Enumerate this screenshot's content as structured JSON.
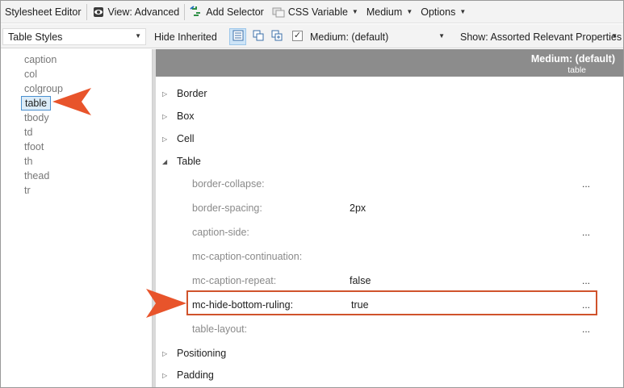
{
  "toolbar": {
    "title": "Stylesheet Editor",
    "view_label": "View: Advanced",
    "add_selector_label": "Add Selector",
    "css_variable_label": "CSS Variable",
    "medium_label": "Medium",
    "options_label": "Options"
  },
  "toolbar2": {
    "style_select": "Table Styles",
    "hide_inherited": "Hide Inherited",
    "medium_select": "Medium: (default)",
    "show_select": "Show: Assorted Relevant Properties"
  },
  "tags": [
    "caption",
    "col",
    "colgroup",
    "table",
    "tbody",
    "td",
    "tfoot",
    "th",
    "thead",
    "tr"
  ],
  "selected_tag": "table",
  "header": {
    "medium": "Medium: (default)",
    "selector": "table"
  },
  "groups": {
    "border": "Border",
    "box": "Box",
    "cell": "Cell",
    "table": "Table",
    "positioning": "Positioning",
    "padding": "Padding"
  },
  "properties": [
    {
      "name": "border-collapse:",
      "value": "",
      "more": "..."
    },
    {
      "name": "border-spacing:",
      "value": "2px",
      "more": ""
    },
    {
      "name": "caption-side:",
      "value": "",
      "more": "..."
    },
    {
      "name": "mc-caption-continuation:",
      "value": "",
      "more": ""
    },
    {
      "name": "mc-caption-repeat:",
      "value": "false",
      "more": "..."
    },
    {
      "name": "mc-hide-bottom-ruling:",
      "value": "true",
      "more": "..."
    },
    {
      "name": "table-layout:",
      "value": "",
      "more": "..."
    }
  ],
  "colors": {
    "callout": "#e8542b",
    "highlight_border": "#d0532c",
    "header_bg": "#8c8c8c"
  }
}
